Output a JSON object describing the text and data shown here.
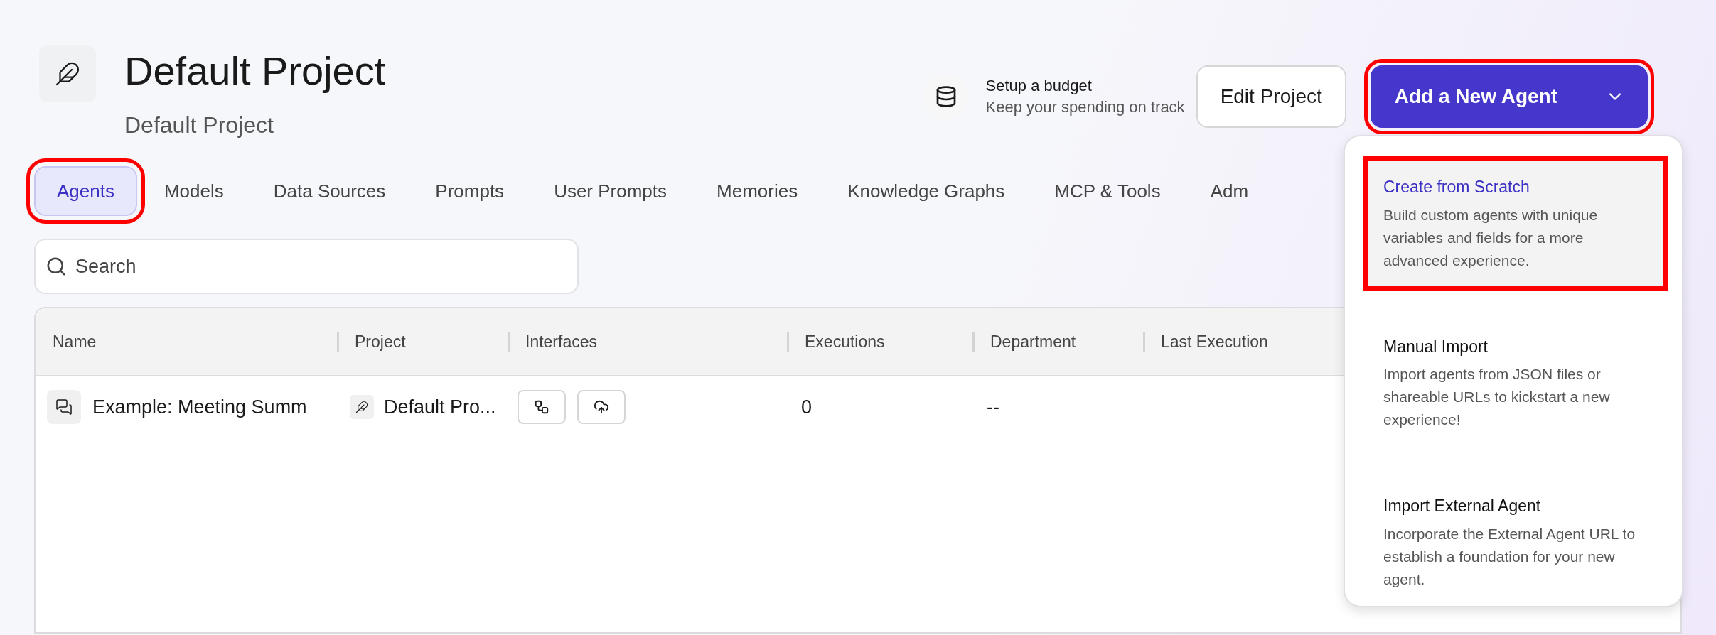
{
  "project": {
    "title": "Default Project",
    "subtitle": "Default Project"
  },
  "budget": {
    "title": "Setup a budget",
    "subtitle": "Keep your spending on track"
  },
  "edit_button": "Edit Project",
  "add_button": {
    "label": "Add a New Agent",
    "highlighted": true
  },
  "tabs": [
    {
      "label": "Agents",
      "selected": true,
      "highlighted": true
    },
    {
      "label": "Models",
      "selected": false,
      "highlighted": false
    },
    {
      "label": "Data Sources",
      "selected": false,
      "highlighted": false
    },
    {
      "label": "Prompts",
      "selected": false,
      "highlighted": false
    },
    {
      "label": "User Prompts",
      "selected": false,
      "highlighted": false
    },
    {
      "label": "Memories",
      "selected": false,
      "highlighted": false
    },
    {
      "label": "Knowledge Graphs",
      "selected": false,
      "highlighted": false
    },
    {
      "label": "MCP & Tools",
      "selected": false,
      "highlighted": false
    },
    {
      "label": "Adm",
      "selected": false,
      "highlighted": false
    }
  ],
  "search": {
    "placeholder": "Search"
  },
  "table": {
    "columns": [
      "Name",
      "Project",
      "Interfaces",
      "Executions",
      "Department",
      "Last Execution"
    ],
    "rows": [
      {
        "name": "Example: Meeting Summ",
        "project": "Default Pro...",
        "executions": "0",
        "department": "--"
      }
    ]
  },
  "menu": [
    {
      "title": "Create from Scratch",
      "description": "Build custom agents with unique variables and fields for a more advanced experience.",
      "selected": true,
      "highlighted": true
    },
    {
      "title": "Manual Import",
      "description": "Import agents from JSON files or shareable URLs to kickstart a new experience!",
      "selected": false,
      "highlighted": false
    },
    {
      "title": "Import External Agent",
      "description": "Incorporate the External Agent URL to establish a foundation for your new agent.",
      "selected": false,
      "highlighted": false
    }
  ]
}
